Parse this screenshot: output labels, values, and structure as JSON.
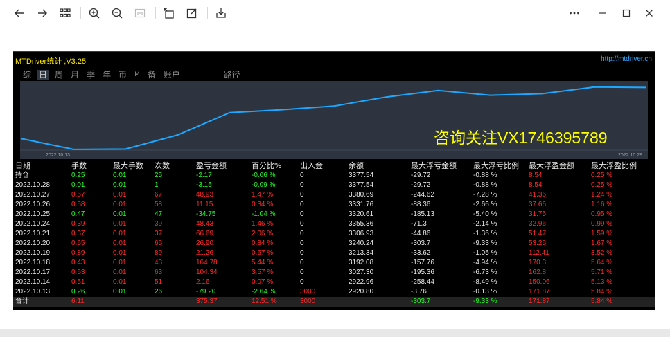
{
  "toolbar": {
    "buttons": [
      "back-icon",
      "forward-icon",
      "grid-icon",
      "zoom-in-icon",
      "zoom-out-icon",
      "fit-icon",
      "rotate-icon",
      "edit-icon",
      "save-icon",
      "more-icon",
      "minimize-icon",
      "maximize-icon",
      "close-icon"
    ]
  },
  "report": {
    "title": "MTDriver统计 ,V3.25",
    "site": "http://mtdriver.cn",
    "tabs": [
      "综",
      "日",
      "周",
      "月",
      "季",
      "年",
      "币",
      "M",
      "备",
      "账户",
      "路径"
    ],
    "active_tab": "日",
    "watermark": "咨询关注VX1746395789",
    "date_start": "2022.10.13",
    "date_end": "2022.10.28",
    "colors": {
      "line": "#1ea8ff",
      "chart_bg": "#2d3440",
      "gain": "#22ff22",
      "loss": "#ff2a2a"
    },
    "headers": [
      "日期",
      "手数",
      "最大手数",
      "次数",
      "盈亏金额",
      "百分比%",
      "出入金",
      "余额",
      "最大浮亏金额",
      "最大浮亏比例",
      "最大浮盈金额",
      "最大浮盈比例"
    ],
    "rows": [
      {
        "date": "持仓",
        "lots": "0.25",
        "maxlots": "0.01",
        "count": "25",
        "pnl": "-2.17",
        "pct": "-0.06 %",
        "io": "0",
        "balance": "3377.54",
        "mfl": "-29.72",
        "mflp": "-0.88 %",
        "mfg": "8.54",
        "mfgp": "0.25 %",
        "sign": "g"
      },
      {
        "date": "2022.10.28",
        "lots": "0.01",
        "maxlots": "0.01",
        "count": "1",
        "pnl": "-3.15",
        "pct": "-0.09 %",
        "io": "0",
        "balance": "3377.54",
        "mfl": "-29.72",
        "mflp": "-0.88 %",
        "mfg": "8.54",
        "mfgp": "0.25 %",
        "sign": "g"
      },
      {
        "date": "2022.10.27",
        "lots": "0.67",
        "maxlots": "0.01",
        "count": "67",
        "pnl": "48.93",
        "pct": "1.47 %",
        "io": "0",
        "balance": "3380.69",
        "mfl": "-244.62",
        "mflp": "-7.28 %",
        "mfg": "41.36",
        "mfgp": "1.24 %",
        "sign": "r"
      },
      {
        "date": "2022.10.26",
        "lots": "0.58",
        "maxlots": "0.01",
        "count": "58",
        "pnl": "11.15",
        "pct": "0.34 %",
        "io": "0",
        "balance": "3331.76",
        "mfl": "-88.36",
        "mflp": "-2.66 %",
        "mfg": "37.66",
        "mfgp": "1.16 %",
        "sign": "r"
      },
      {
        "date": "2022.10.25",
        "lots": "0.47",
        "maxlots": "0.01",
        "count": "47",
        "pnl": "-34.75",
        "pct": "-1.04 %",
        "io": "0",
        "balance": "3320.61",
        "mfl": "-185.13",
        "mflp": "-5.40 %",
        "mfg": "31.75",
        "mfgp": "0.95 %",
        "sign": "g"
      },
      {
        "date": "2022.10.24",
        "lots": "0.39",
        "maxlots": "0.01",
        "count": "39",
        "pnl": "48.43",
        "pct": "1.46 %",
        "io": "0",
        "balance": "3355.36",
        "mfl": "-71.3",
        "mflp": "-2.14 %",
        "mfg": "32.96",
        "mfgp": "0.99 %",
        "sign": "r"
      },
      {
        "date": "2022.10.21",
        "lots": "0.37",
        "maxlots": "0.01",
        "count": "37",
        "pnl": "66.69",
        "pct": "2.06 %",
        "io": "0",
        "balance": "3306.93",
        "mfl": "-44.86",
        "mflp": "-1.36 %",
        "mfg": "51.47",
        "mfgp": "1.59 %",
        "sign": "r"
      },
      {
        "date": "2022.10.20",
        "lots": "0.65",
        "maxlots": "0.01",
        "count": "65",
        "pnl": "26.90",
        "pct": "0.84 %",
        "io": "0",
        "balance": "3240.24",
        "mfl": "-303.7",
        "mflp": "-9.33 %",
        "mfg": "53.25",
        "mfgp": "1.67 %",
        "sign": "r"
      },
      {
        "date": "2022.10.19",
        "lots": "0.89",
        "maxlots": "0.01",
        "count": "89",
        "pnl": "21.26",
        "pct": "0.67 %",
        "io": "0",
        "balance": "3213.34",
        "mfl": "-33.62",
        "mflp": "-1.05 %",
        "mfg": "112.41",
        "mfgp": "3.52 %",
        "sign": "r"
      },
      {
        "date": "2022.10.18",
        "lots": "0.43",
        "maxlots": "0.01",
        "count": "43",
        "pnl": "164.78",
        "pct": "5.44 %",
        "io": "0",
        "balance": "3192.08",
        "mfl": "-157.76",
        "mflp": "-4.94 %",
        "mfg": "170.3",
        "mfgp": "5.64 %",
        "sign": "r"
      },
      {
        "date": "2022.10.17",
        "lots": "0.63",
        "maxlots": "0.01",
        "count": "63",
        "pnl": "104.34",
        "pct": "3.57 %",
        "io": "0",
        "balance": "3027.30",
        "mfl": "-195.36",
        "mflp": "-6.73 %",
        "mfg": "162.8",
        "mfgp": "5.71 %",
        "sign": "r"
      },
      {
        "date": "2022.10.14",
        "lots": "0.51",
        "maxlots": "0.01",
        "count": "51",
        "pnl": "2.16",
        "pct": "0.07 %",
        "io": "0",
        "balance": "2922.96",
        "mfl": "-258.44",
        "mflp": "-8.49 %",
        "mfg": "150.06",
        "mfgp": "5.13 %",
        "sign": "r"
      },
      {
        "date": "2022.10.13",
        "lots": "0.26",
        "maxlots": "0.01",
        "count": "26",
        "pnl": "-79.20",
        "pct": "-2.64 %",
        "io": "3000",
        "balance": "2920.80",
        "mfl": "-3.76",
        "mflp": "-0.13 %",
        "mfg": "171.87",
        "mfgp": "5.84 %",
        "sign": "g"
      }
    ],
    "total": {
      "date": "合计",
      "lots": "6.11",
      "maxlots": "",
      "count": "",
      "pnl": "375.37",
      "pct": "12.51 %",
      "io": "3000",
      "balance": "",
      "mfl": "-303.7",
      "mflp": "-9.33 %",
      "mfg": "171.87",
      "mfgp": "5.84 %"
    }
  },
  "chart_data": {
    "type": "line",
    "x": [
      "2022.10.13",
      "2022.10.14",
      "2022.10.17",
      "2022.10.18",
      "2022.10.19",
      "2022.10.20",
      "2022.10.21",
      "2022.10.24",
      "2022.10.25",
      "2022.10.26",
      "2022.10.27",
      "2022.10.28"
    ],
    "series": [
      {
        "values": [
          2920.8,
          2922.96,
          3027.3,
          3192.08,
          3213.34,
          3240.24,
          3306.93,
          3355.36,
          3320.61,
          3331.76,
          3380.69,
          3377.54
        ]
      }
    ],
    "start_value": 3000,
    "ylim": [
      2915,
      3395
    ]
  }
}
